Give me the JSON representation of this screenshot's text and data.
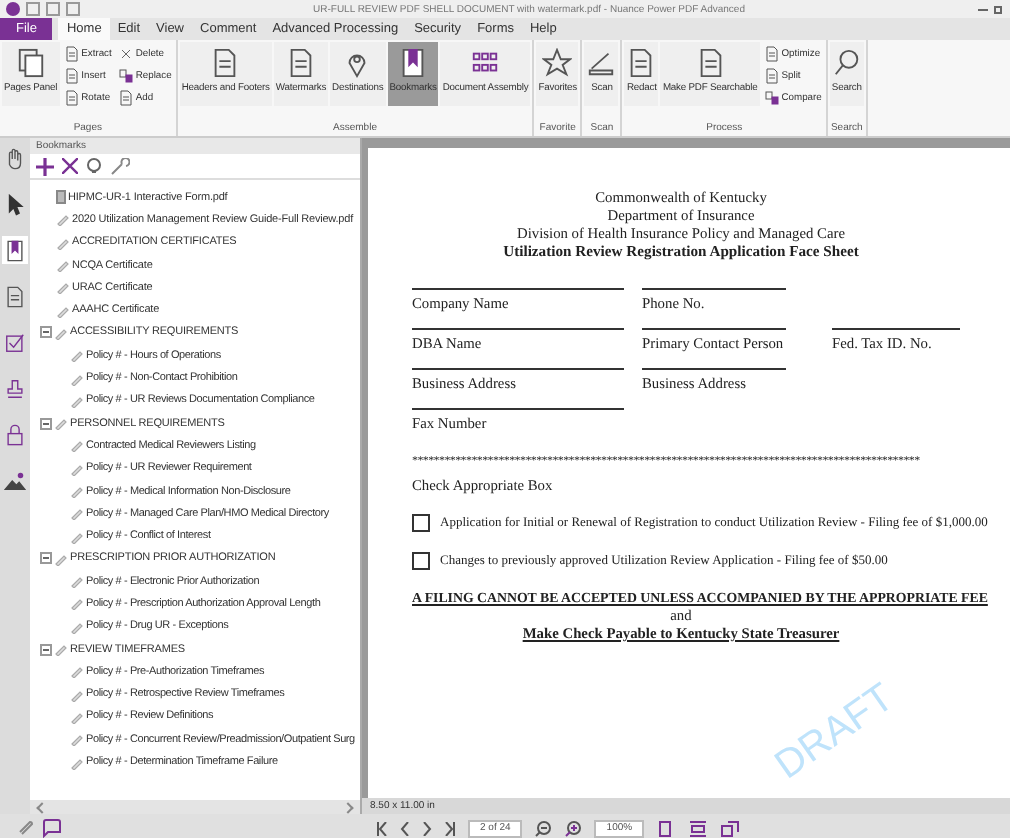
{
  "window": {
    "title": "UR-FULL REVIEW PDF SHELL DOCUMENT with watermark.pdf - Nuance Power PDF Advanced"
  },
  "menu": [
    {
      "label": "File",
      "kind": "file"
    },
    {
      "label": "Home",
      "kind": "tab",
      "selected": true
    },
    {
      "label": "Edit",
      "kind": "tab",
      "selected": false
    },
    {
      "label": "View",
      "kind": "tab",
      "selected": false
    },
    {
      "label": "Comment",
      "kind": "tab",
      "selected": false
    },
    {
      "label": "Advanced Processing",
      "kind": "tab",
      "selected": false
    },
    {
      "label": "Security",
      "kind": "tab",
      "selected": false
    },
    {
      "label": "Forms",
      "kind": "tab",
      "selected": false
    },
    {
      "label": "Help",
      "kind": "tab",
      "selected": false
    }
  ],
  "ribbon": [
    {
      "group": "Pages",
      "items": [
        {
          "label": "Pages Panel",
          "kind": "big",
          "selected": false
        },
        {
          "kind": "stack",
          "items": [
            {
              "label": "Extract"
            },
            {
              "label": "Insert"
            },
            {
              "label": "Rotate"
            }
          ]
        },
        {
          "kind": "stack",
          "items": [
            {
              "label": "Delete"
            },
            {
              "label": "Replace"
            },
            {
              "label": "Add"
            }
          ]
        }
      ]
    },
    {
      "group": "Assemble",
      "items": [
        {
          "label": "Headers and Footers",
          "kind": "big",
          "selected": false
        },
        {
          "label": "Watermarks",
          "kind": "big",
          "selected": false
        },
        {
          "label": "Destinations",
          "kind": "big",
          "selected": false
        },
        {
          "label": "Bookmarks",
          "kind": "big",
          "selected": true
        },
        {
          "label": "Document Assembly",
          "kind": "big",
          "selected": false
        }
      ]
    },
    {
      "group": "Favorite",
      "items": [
        {
          "label": "Favorites",
          "kind": "big",
          "selected": false
        }
      ]
    },
    {
      "group": "Scan",
      "items": [
        {
          "label": "Scan",
          "kind": "big",
          "selected": false
        }
      ]
    },
    {
      "group": "Process",
      "items": [
        {
          "label": "Redact",
          "kind": "big",
          "selected": false
        },
        {
          "label": "Make PDF Searchable",
          "kind": "big",
          "selected": false
        },
        {
          "kind": "stack",
          "items": [
            {
              "label": "Optimize"
            },
            {
              "label": "Split"
            },
            {
              "label": "Compare"
            }
          ]
        }
      ]
    },
    {
      "group": "Search",
      "items": [
        {
          "label": "Search",
          "kind": "big",
          "selected": false
        }
      ]
    }
  ],
  "side_strip": [
    {
      "selected": false
    },
    {
      "selected": false
    },
    {
      "selected": true
    },
    {
      "selected": false
    },
    {
      "selected": false
    },
    {
      "selected": false
    },
    {
      "selected": false
    },
    {
      "selected": false
    }
  ],
  "bookmarks": {
    "title": "Bookmarks",
    "items": [
      {
        "label": "HIPMC-UR-1 Interactive Form.pdf"
      },
      {
        "label": "2020 Utilization Management Review Guide-Full Review.pdf"
      },
      {
        "label": "ACCREDITATION CERTIFICATES"
      },
      {
        "label": "NCQA Certificate"
      },
      {
        "label": "URAC Certificate"
      },
      {
        "label": "AAAHC Certificate"
      },
      {
        "label": "ACCESSIBILITY REQUIREMENTS",
        "expanded": true,
        "children": [
          {
            "label": "Policy # - Hours of Operations"
          },
          {
            "label": "Policy # - Non-Contact Prohibition"
          },
          {
            "label": "Policy # - UR Reviews Documentation Compliance"
          }
        ]
      },
      {
        "label": "PERSONNEL REQUIREMENTS",
        "expanded": true,
        "children": [
          {
            "label": "Contracted Medical Reviewers Listing"
          },
          {
            "label": "Policy # - UR Reviewer Requirement"
          },
          {
            "label": "Policy # - Medical Information Non-Disclosure"
          },
          {
            "label": "Policy # - Managed Care Plan/HMO Medical Directory"
          },
          {
            "label": "Policy # - Conflict of Interest"
          }
        ]
      },
      {
        "label": "PRESCRIPTION PRIOR AUTHORIZATION",
        "expanded": true,
        "children": [
          {
            "label": "Policy # - Electronic Prior Authorization"
          },
          {
            "label": "Policy # - Prescription Authorization Approval Length"
          },
          {
            "label": "Policy # - Drug UR - Exceptions"
          }
        ]
      },
      {
        "label": "REVIEW TIMEFRAMES",
        "expanded": true,
        "children": [
          {
            "label": "Policy # - Pre-Authorization Timeframes"
          },
          {
            "label": "Policy # - Retrospective Review Timeframes"
          },
          {
            "label": "Policy # - Review Definitions"
          },
          {
            "label": "Policy # - Concurrent Review/Preadmission/Outpatient Surg"
          },
          {
            "label": "Policy # - Determination Timeframe Failure"
          }
        ]
      }
    ]
  },
  "document": {
    "header": [
      "Commonwealth of Kentucky",
      "Department of Insurance",
      "Division of Health Insurance Policy and Managed Care"
    ],
    "title": "Utilization Review Registration Application Face Sheet",
    "field_rows": [
      [
        "Company Name",
        "Phone No."
      ],
      [
        "DBA Name",
        "Primary Contact Person",
        "Fed. Tax ID. No."
      ],
      [
        "Business Address",
        "Business Address"
      ],
      [
        "Fax Number"
      ]
    ],
    "separator": "**********************************************************************************************",
    "check_heading": "Check Appropriate Box",
    "options": [
      {
        "label": "Application for Initial or Renewal of Registration to conduct Utilization Review - Filing fee of $1,000.00",
        "checked": false
      },
      {
        "label": "Changes to previously approved Utilization Review Application - Filing fee of $50.00",
        "checked": false
      }
    ],
    "notice": "A FILING CANNOT BE ACCEPTED UNLESS ACCOMPANIED BY THE APPROPRIATE FEE",
    "and": "and",
    "payable": "Make Check Payable to Kentucky State Treasurer",
    "watermark": "DRAFT"
  },
  "page_size": "8.50 x 11.00 in",
  "nav": {
    "page": "2 of 24",
    "zoom": "100%"
  }
}
